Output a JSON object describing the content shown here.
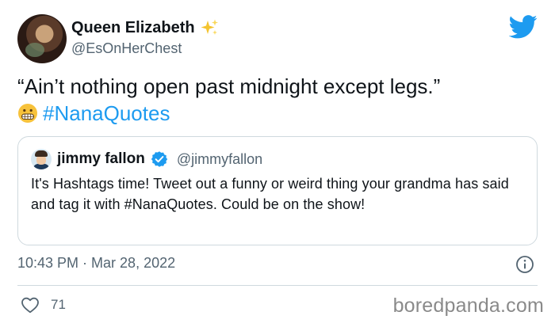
{
  "author": {
    "display_name": "Queen Elizabeth",
    "name_emoji": "sparkles-icon",
    "handle": "@EsOnHerChest"
  },
  "tweet": {
    "text": "“Ain’t nothing open past midnight except legs.”",
    "emoji": "grimacing-face-icon",
    "hashtag": "#NanaQuotes",
    "timestamp": "10:43 PM · Mar 28, 2022",
    "like_count": "71"
  },
  "quoted_tweet": {
    "display_name": "jimmy fallon",
    "handle": "@jimmyfallon",
    "verified": true,
    "text": "It's Hashtags time! Tweet out a funny or weird thing your grandma has said and tag it with #NanaQuotes. Could be on the show!"
  },
  "watermark": "boredpanda.com",
  "colors": {
    "accent": "#1d9bf0",
    "secondary_text": "#536471",
    "border": "#cfd9de"
  }
}
